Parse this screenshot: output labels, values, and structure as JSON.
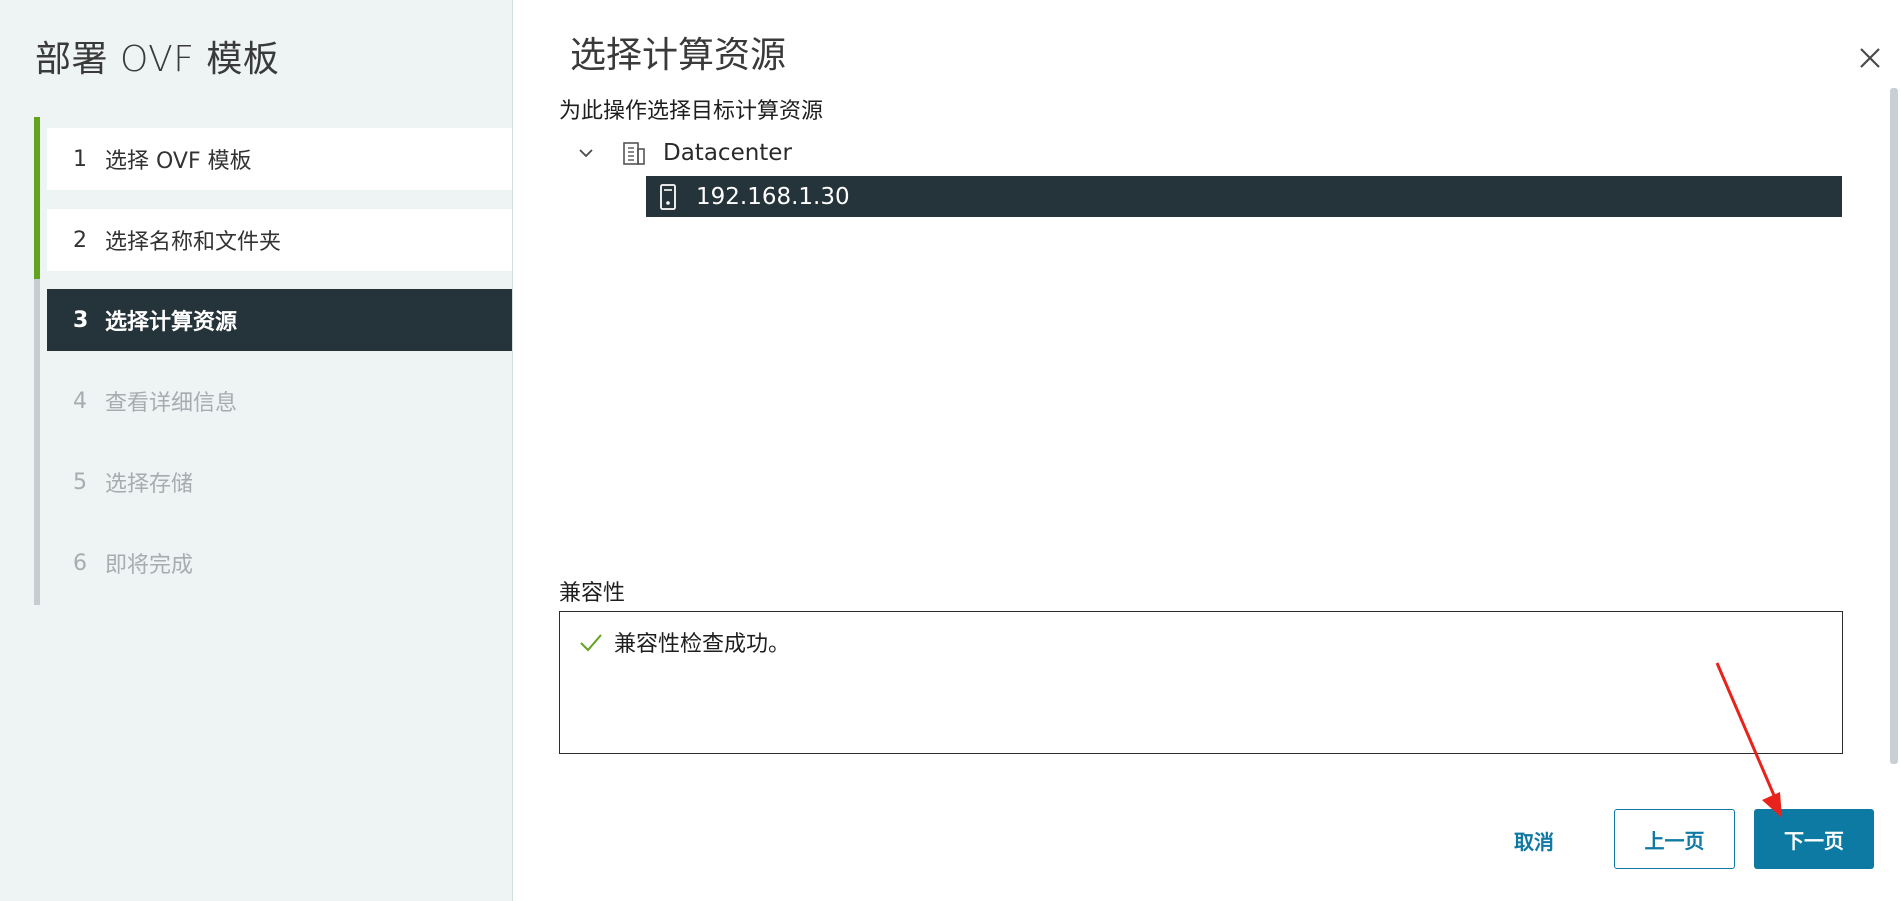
{
  "sidebar": {
    "title": "部署 OVF 模板",
    "steps": [
      {
        "num": "1",
        "label": "选择 OVF 模板",
        "state": "done"
      },
      {
        "num": "2",
        "label": "选择名称和文件夹",
        "state": "done"
      },
      {
        "num": "3",
        "label": "选择计算资源",
        "state": "active"
      },
      {
        "num": "4",
        "label": "查看详细信息",
        "state": "pending"
      },
      {
        "num": "5",
        "label": "选择存储",
        "state": "pending"
      },
      {
        "num": "6",
        "label": "即将完成",
        "state": "pending"
      }
    ]
  },
  "main": {
    "title": "选择计算资源",
    "subtitle": "为此操作选择目标计算资源",
    "tree": {
      "datacenter": {
        "label": "Datacenter",
        "icon": "datacenter-icon",
        "expanded": true
      },
      "host": {
        "label": "192.168.1.30",
        "icon": "host-icon",
        "selected": true
      }
    },
    "compatibility": {
      "label": "兼容性",
      "message": "兼容性检查成功。",
      "icon": "check-icon",
      "status_color": "#62a420"
    }
  },
  "footer": {
    "cancel_label": "取消",
    "back_label": "上一页",
    "next_label": "下一页"
  },
  "colors": {
    "accent": "#0c7aa2",
    "active_step_bg": "#25333a",
    "done_rail": "#62a420",
    "annotation_arrow": "#e8231b"
  },
  "annotation": {
    "type": "arrow",
    "points_to": "next-button"
  }
}
